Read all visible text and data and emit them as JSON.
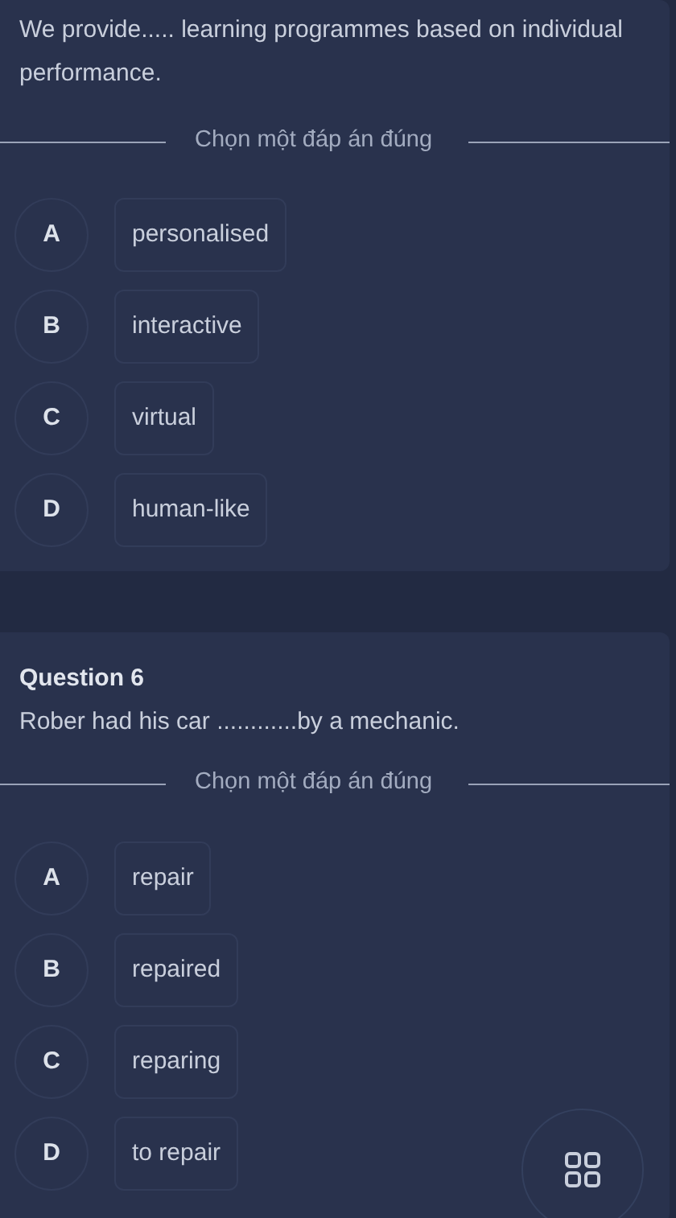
{
  "questions": [
    {
      "prompt": "We provide..... learning programmes based on individual performance.",
      "instruction": "Chọn một đáp án đúng",
      "options": [
        {
          "letter": "A",
          "text": "personalised"
        },
        {
          "letter": "B",
          "text": "interactive"
        },
        {
          "letter": "C",
          "text": "virtual"
        },
        {
          "letter": "D",
          "text": "human-like"
        }
      ]
    },
    {
      "title": "Question 6",
      "prompt": "Rober had his car ............by a mechanic.",
      "instruction": "Chọn một đáp án đúng",
      "options": [
        {
          "letter": "A",
          "text": "repair"
        },
        {
          "letter": "B",
          "text": "repaired"
        },
        {
          "letter": "C",
          "text": "reparing"
        },
        {
          "letter": "D",
          "text": "to repair"
        }
      ]
    }
  ]
}
